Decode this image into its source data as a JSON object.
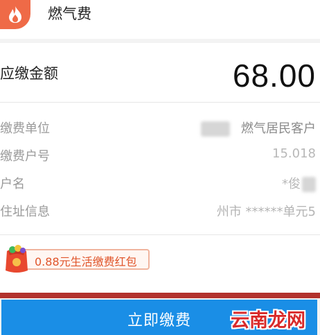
{
  "header": {
    "icon": "flame-icon",
    "title": "燃气费"
  },
  "bill": {
    "amount_label": "应缴金额",
    "amount_value": "68.00",
    "rows": [
      {
        "label": "缴费单位",
        "value": "燃气居民客户"
      },
      {
        "label": "缴费户号",
        "value": "15.018"
      },
      {
        "label": "户名",
        "value": "*俊"
      },
      {
        "label": "住址信息",
        "value": "州市 ******单元5"
      }
    ]
  },
  "coupon": {
    "text": "0.88元生活缴费红包"
  },
  "footer": {
    "pay_label": "立即缴费",
    "watermark": "云南龙网"
  },
  "colors": {
    "brand": "#ef6a47",
    "pay_button": "#1a8ee6",
    "coupon_text": "#e0552b"
  }
}
